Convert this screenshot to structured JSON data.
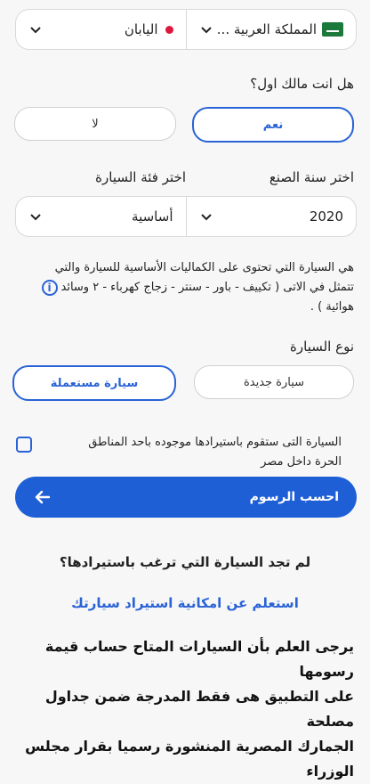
{
  "selectors": {
    "origin_country": "المملكة العربية ...",
    "destination_country": "اليابان"
  },
  "first_owner": {
    "question": "هل انت مالك اول؟",
    "yes": "نعم",
    "no": "لا"
  },
  "labels": {
    "year": "اختر سنة الصنع",
    "category": "اختر فئة السيارة"
  },
  "year_select": {
    "value": "2020"
  },
  "category_select": {
    "value": "أساسية"
  },
  "info_note": {
    "line1": "هي السيارة التي تحتوى على الكماليات الأساسية للسيارة والتي",
    "line2": "تتمثل في الاتى ( تكييف - باور - سنتر - زجاج كهرباء - ٢ وسائد",
    "line3": "هوائية ) ."
  },
  "car_type": {
    "label": "نوع السيارة",
    "new": "سيارة جديدة",
    "used": "سيارة مستعملة"
  },
  "free_zone": {
    "line1": "السيارة التى ستقوم باستيرادها موجوده باحد المناطق",
    "line2": "الحرة داخل مصر"
  },
  "calculate_button": "احسب الرسوم",
  "not_found": {
    "question": "لم تجد السيارة التي ترغب باستيرادها؟",
    "link": "استعلم عن امكانية استيراد سيارتك"
  },
  "disclaimer": {
    "line1": "يرجى العلم بأن السيارات المتاح حساب قيمة رسومها",
    "line2": "على التطبيق هى فقط المدرجة ضمن جداول مصلحة",
    "line3": "الجمارك المصرية المنشورة رسميا بقرار مجلس الوزراء"
  },
  "colors": {
    "accent": "#2a63d6",
    "button": "#1f5fd6"
  },
  "icons": {
    "flag_sa": "saudi-flag-icon",
    "flag_jp": "japan-dot-icon",
    "chevron": "chevron-down-icon",
    "info": "info-icon",
    "arrow": "arrow-left-icon"
  }
}
